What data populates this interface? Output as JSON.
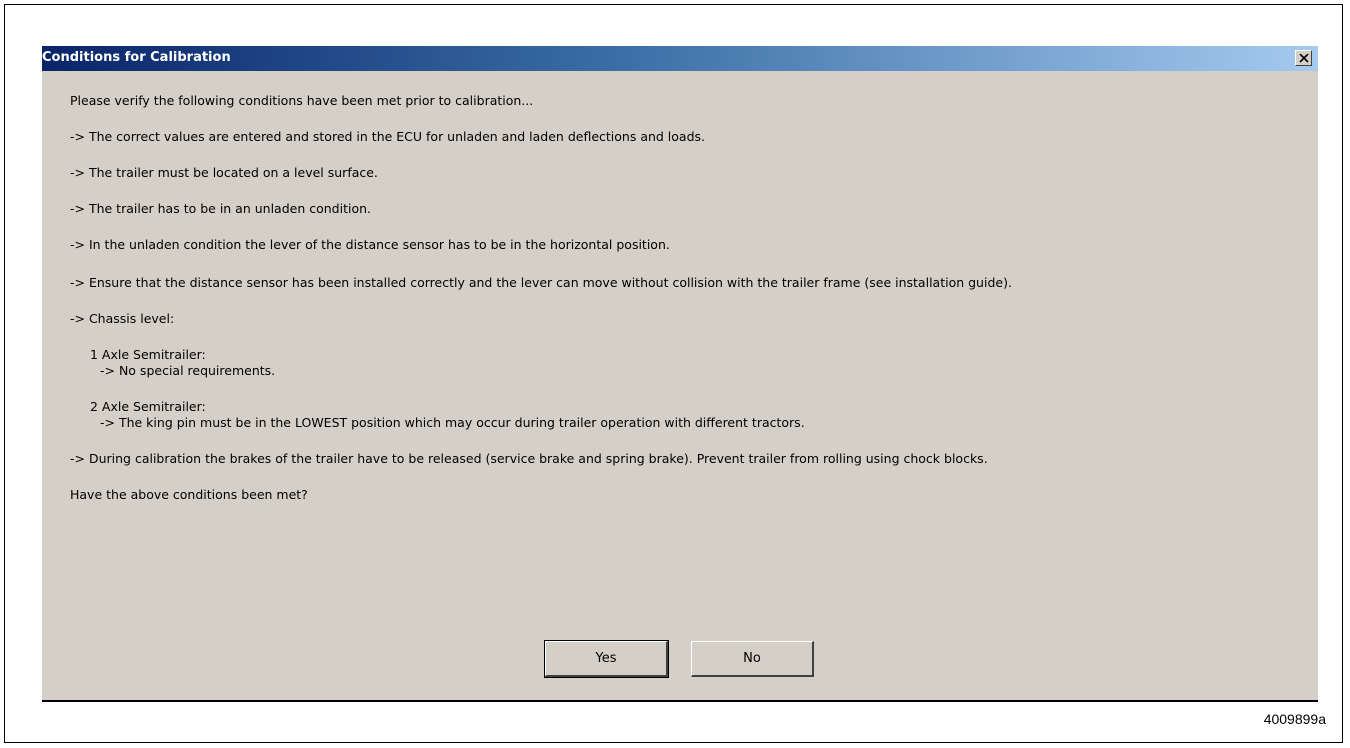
{
  "dialog": {
    "title": "Conditions for Calibration",
    "close_icon": "close-x-icon",
    "intro": "Please verify the following conditions have been met prior to calibration...",
    "conditions": [
      "-> The correct values are entered and stored in the ECU for unladen and laden deflections and loads.",
      "-> The trailer must be located on a level surface.",
      "-> The trailer has to be in an unladen condition.",
      "-> In the unladen condition the lever of the distance sensor has to be in the horizontal position.",
      "-> Ensure that the distance sensor has been installed correctly and the lever can move without collision with the trailer frame (see installation guide).",
      "-> Chassis level:"
    ],
    "chassis": {
      "one_axle_title": "1 Axle Semitrailer:",
      "one_axle_note": "-> No special requirements.",
      "two_axle_title": "2 Axle Semitrailer:",
      "two_axle_note": "-> The king pin must be in the LOWEST position which may occur during trailer operation with different tractors."
    },
    "brakes_note": "-> During calibration the brakes of the trailer have to be released (service brake and spring brake).  Prevent trailer from rolling using chock blocks.",
    "question": "Have the above conditions been met?",
    "yes_label": "Yes",
    "no_label": "No"
  },
  "figure_id": "4009899a",
  "colors": {
    "titlebar_start": "#0a246a",
    "titlebar_end": "#a6caf0",
    "dialog_face": "#d4d0c8"
  }
}
